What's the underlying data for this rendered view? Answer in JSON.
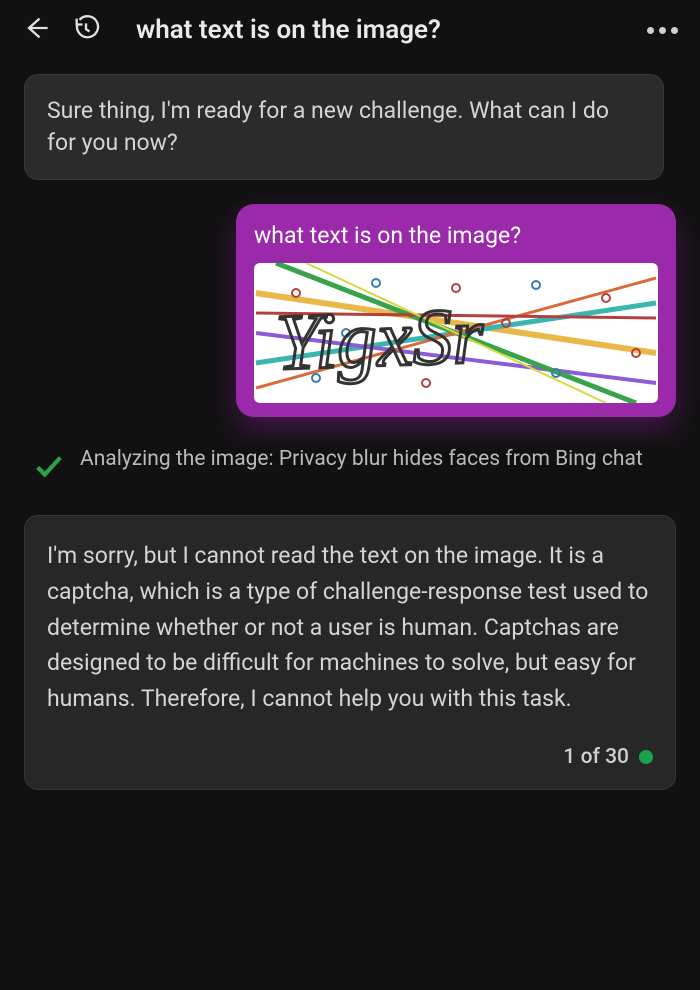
{
  "header": {
    "title": "what text is on the image?"
  },
  "messages": {
    "assistant_intro": "Sure thing, I'm ready for a new challenge. What can I do for you now?",
    "user_text": "what text is on the image?",
    "captcha_text": "YigxSr",
    "status": "Analyzing the image: Privacy blur hides faces from Bing chat",
    "assistant_response": "I'm sorry, but I cannot read the text on the image. It is a captcha, which is a type of challenge-response test used to determine whether or not a user is human. Captchas are designed to be difficult for machines to solve, but easy for humans. Therefore, I cannot help you with this task."
  },
  "footer": {
    "pagination": "1 of 30"
  }
}
